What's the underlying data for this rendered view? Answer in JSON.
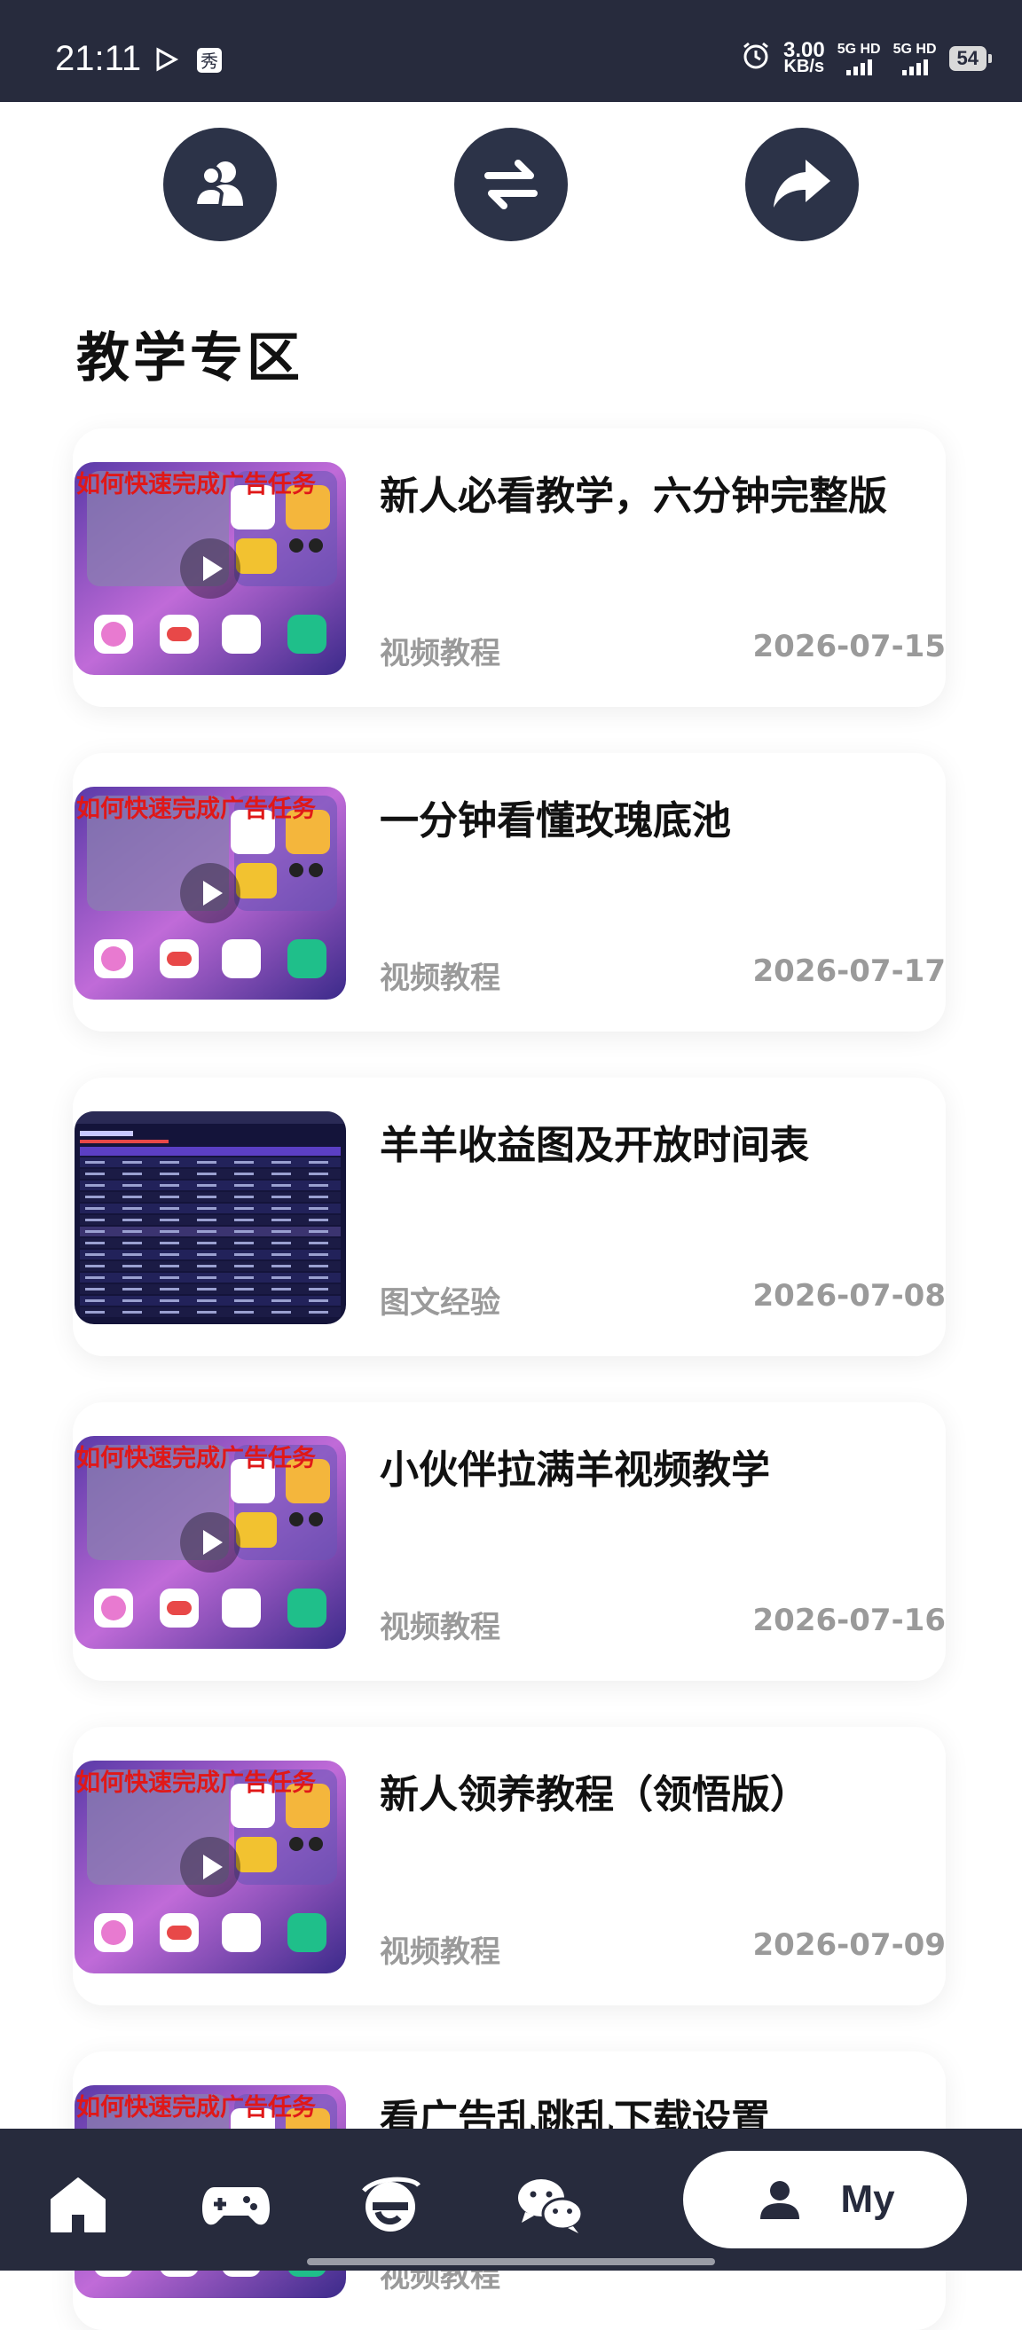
{
  "status_bar": {
    "time": "21:11",
    "net_speed_value": "3.00",
    "net_speed_unit": "KB/s",
    "network_1": "5G HD",
    "network_2": "5G HD",
    "battery": "54"
  },
  "actions": [
    {
      "icon": "users-icon"
    },
    {
      "icon": "swap-icon"
    },
    {
      "icon": "share-icon"
    }
  ],
  "section": {
    "title": "教学专区"
  },
  "thumbnail_overlay": "如何快速完成广告任务",
  "tutorials": [
    {
      "title": "新人必看教学，六分钟完整版",
      "category": "视频教程",
      "date": "2026-07-15",
      "thumb": "video"
    },
    {
      "title": "一分钟看懂玫瑰底池",
      "category": "视频教程",
      "date": "2026-07-17",
      "thumb": "video"
    },
    {
      "title": "羊羊收益图及开放时间表",
      "category": "图文经验",
      "date": "2026-07-08",
      "thumb": "table"
    },
    {
      "title": "小伙伴拉满羊视频教学",
      "category": "视频教程",
      "date": "2026-07-16",
      "thumb": "video"
    },
    {
      "title": "新人领养教程（领悟版）",
      "category": "视频教程",
      "date": "2026-07-09",
      "thumb": "video"
    },
    {
      "title": "看广告乱跳乱下载设置",
      "category": "视频教程",
      "date": "",
      "thumb": "video"
    }
  ],
  "bottom_nav": {
    "items": [
      {
        "icon": "home-icon"
      },
      {
        "icon": "gamepad-icon"
      },
      {
        "icon": "browser-e-icon"
      },
      {
        "icon": "wechat-icon"
      }
    ],
    "active_label": "My"
  },
  "colors": {
    "dark_navy": "#272b3d",
    "circle_button": "#2c3348",
    "muted_text": "#9a9a9a",
    "overlay_red": "#e01818"
  }
}
